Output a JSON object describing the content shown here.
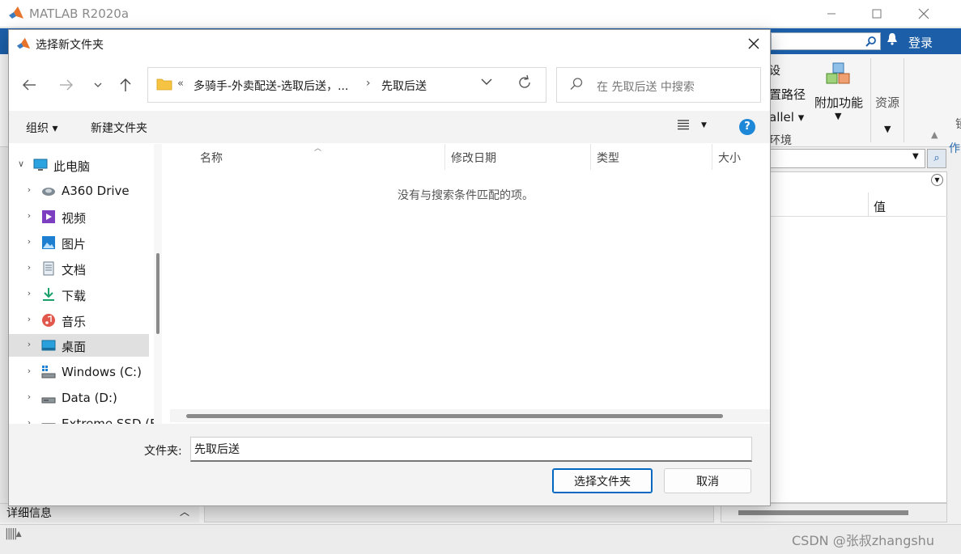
{
  "matlab": {
    "title": "MATLAB R2020a",
    "login": "登录",
    "ribbon": {
      "item1": "设",
      "item2": "置路径",
      "item3": "allel ▾",
      "item4": "环境",
      "addons_label": "附加功能",
      "resources_label": "资源"
    },
    "side_text1": "锁",
    "side_text2": "作",
    "workspace_value_header": "值",
    "details_label": "详细信息",
    "watermark": "CSDN @张叔zhangshu"
  },
  "dialog": {
    "title": "选择新文件夹",
    "address": {
      "prefix": "«",
      "segment1": "多骑手-外卖配送-选取后送，...",
      "separator": "›",
      "segment2": "先取后送"
    },
    "search_placeholder": "在 先取后送 中搜索",
    "commands": {
      "organize": "组织 ▾",
      "new_folder": "新建文件夹"
    },
    "nav_tree": [
      {
        "label": "此电脑",
        "icon": "computer-icon",
        "expanded": true
      },
      {
        "label": "A360 Drive",
        "icon": "cloud-drive-icon"
      },
      {
        "label": "视频",
        "icon": "video-icon"
      },
      {
        "label": "图片",
        "icon": "pictures-icon"
      },
      {
        "label": "文档",
        "icon": "documents-icon"
      },
      {
        "label": "下载",
        "icon": "download-icon"
      },
      {
        "label": "音乐",
        "icon": "music-icon"
      },
      {
        "label": "桌面",
        "icon": "desktop-icon",
        "selected": true
      },
      {
        "label": "Windows (C:)",
        "icon": "drive-c-icon"
      },
      {
        "label": "Data (D:)",
        "icon": "drive-d-icon"
      },
      {
        "label": "Extreme SSD (F",
        "icon": "external-drive-icon"
      }
    ],
    "columns": [
      "名称",
      "修改日期",
      "类型",
      "大小"
    ],
    "empty_message": "没有与搜索条件匹配的项。",
    "folder_label": "文件夹:",
    "folder_value": "先取后送",
    "select_button": "选择文件夹",
    "cancel_button": "取消"
  },
  "colors": {
    "matlab_blue": "#1c5fa8",
    "accent_button": "#0067c0",
    "help_blue": "#1e88d8",
    "folder_yellow": "#f6c342"
  }
}
